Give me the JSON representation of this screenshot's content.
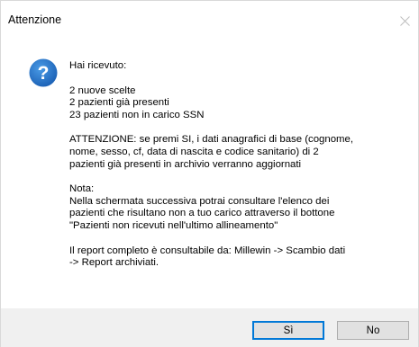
{
  "window": {
    "title": "Attenzione",
    "close_icon": "close-icon"
  },
  "icon": {
    "name": "question-icon",
    "color": "#1f6fc5"
  },
  "message": {
    "intro": "Hai ricevuto:",
    "counts": "2 nuove scelte\n2 pazienti già presenti\n23 pazienti non in carico SSN",
    "warning": "ATTENZIONE: se premi SI, i dati anagrafici di base (cognome,\nnome, sesso, cf, data di nascita e codice sanitario) di 2\npazienti già presenti in archivio verranno aggiornati",
    "note": "Nota:\nNella schermata successiva potrai consultare l'elenco dei\npazienti che risultano non a tuo carico attraverso il bottone\n\"Pazienti non ricevuti nell'ultimo allineamento\"",
    "report": "Il report completo è consultabile da: Millewin -> Scambio dati\n-> Report archiviati."
  },
  "buttons": {
    "yes_label": "Sì",
    "no_label": "No"
  }
}
